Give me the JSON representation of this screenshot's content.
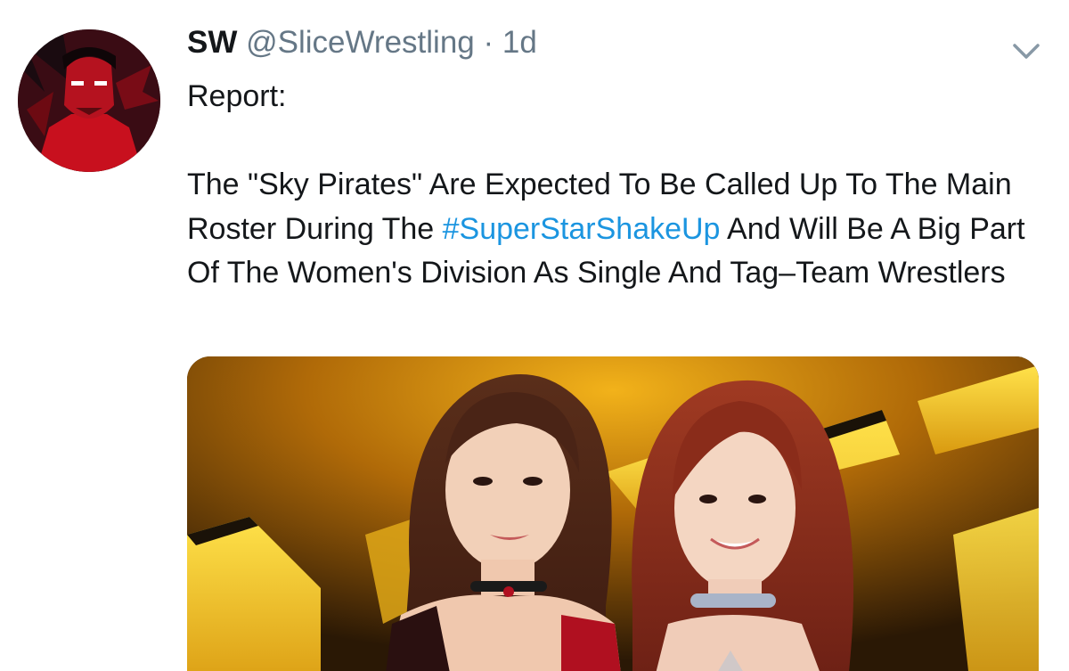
{
  "tweet": {
    "display_name": "SW",
    "handle": "@SliceWrestling",
    "separator": "·",
    "time": "1d",
    "text_line1": "Report:",
    "text_part1": "The \"Sky Pirates\" Are Expected To Be Called Up To The Main Roster During The ",
    "hashtag": "#SuperStarShakeUp",
    "text_part2": " And Will Be A Big Part Of The Women's Division As Single And Tag–Team Wrestlers"
  },
  "icons": {
    "more": "chevron-down-icon",
    "avatar": "avatar-image",
    "media": "photo-two-wrestlers-nxt-logo"
  },
  "colors": {
    "text": "#14171a",
    "secondary": "#657786",
    "link": "#1b95e0"
  }
}
